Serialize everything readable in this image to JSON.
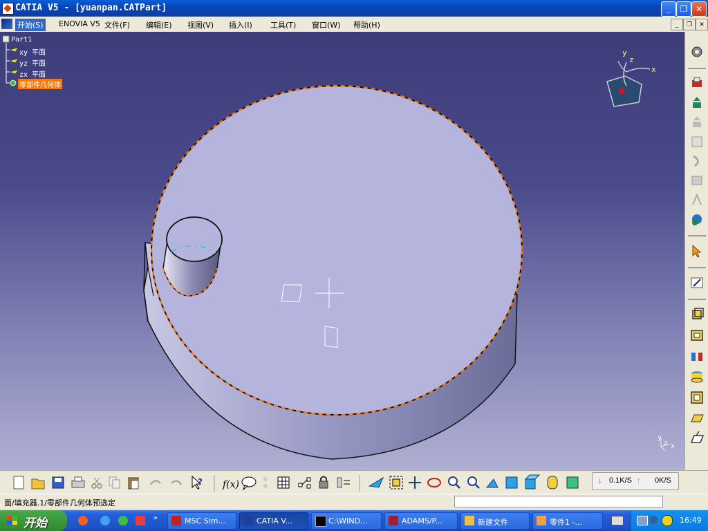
{
  "window": {
    "title": "CATIA V5 - [yuanpan.CATPart]"
  },
  "menu": {
    "items": [
      "开始(S)",
      "ENOVIA V5",
      "文件(F)",
      "编辑(E)",
      "视图(V)",
      "插入(I)",
      "工具(T)",
      "窗口(W)",
      "帮助(H)"
    ]
  },
  "tree": {
    "root": "Part1",
    "items": [
      "xy 平面",
      "yz 平面",
      "zx 平面",
      "零部件几何体"
    ]
  },
  "compass": {
    "x_label": "x",
    "y_label": "y",
    "z_label": "z"
  },
  "axis_mini": {
    "y": "y",
    "z": "z",
    "x": "x"
  },
  "status": {
    "text": "面/填充器.1/零部件几何体预选定"
  },
  "netspeed": {
    "down": "0.1K/S",
    "up": "0K/S"
  },
  "taskbar": {
    "start_label": "开始",
    "tasks": [
      "MSC Sim...",
      "CATIA V...",
      "C:\\WIND...",
      "ADAMS/P...",
      "新建文件",
      "零件1 -..."
    ],
    "clock": "16:49"
  },
  "colors": {
    "selection_orange": "#ff7800",
    "viewport_top": "#3d3d7a",
    "viewport_bottom": "#b0b0d4",
    "part_face": "#b4b4dc"
  },
  "icons": {
    "right_toolbar": [
      "gear-icon",
      "sketch-icon",
      "pad-icon",
      "pocket-icon",
      "shaft-icon",
      "groove-icon",
      "hole-icon",
      "rib-icon",
      "slot-icon",
      "stiffener-icon",
      "loft-icon",
      "select-icon",
      "sketcher-icon",
      "pad-feature-icon",
      "pocket-feature-icon",
      "shell-icon",
      "thickness-icon",
      "edge-fillet-icon",
      "chamfer-icon",
      "draft-icon"
    ],
    "bottom_toolbar": [
      "new-icon",
      "open-icon",
      "save-icon",
      "print-icon",
      "cut-icon",
      "copy-icon",
      "paste-icon",
      "undo-icon",
      "redo-icon",
      "whats-this-icon",
      "formula-icon",
      "knowledge-icon",
      "parameter-icon",
      "table-icon",
      "measure-icon",
      "lock-icon",
      "catalog-icon",
      "fly-icon",
      "fit-all-icon",
      "pan-icon",
      "rotate-icon",
      "zoom-in-icon",
      "zoom-out-icon",
      "normal-view-icon",
      "iso-view-icon",
      "view-mode-icon",
      "hide-show-icon",
      "swap-icon"
    ]
  }
}
